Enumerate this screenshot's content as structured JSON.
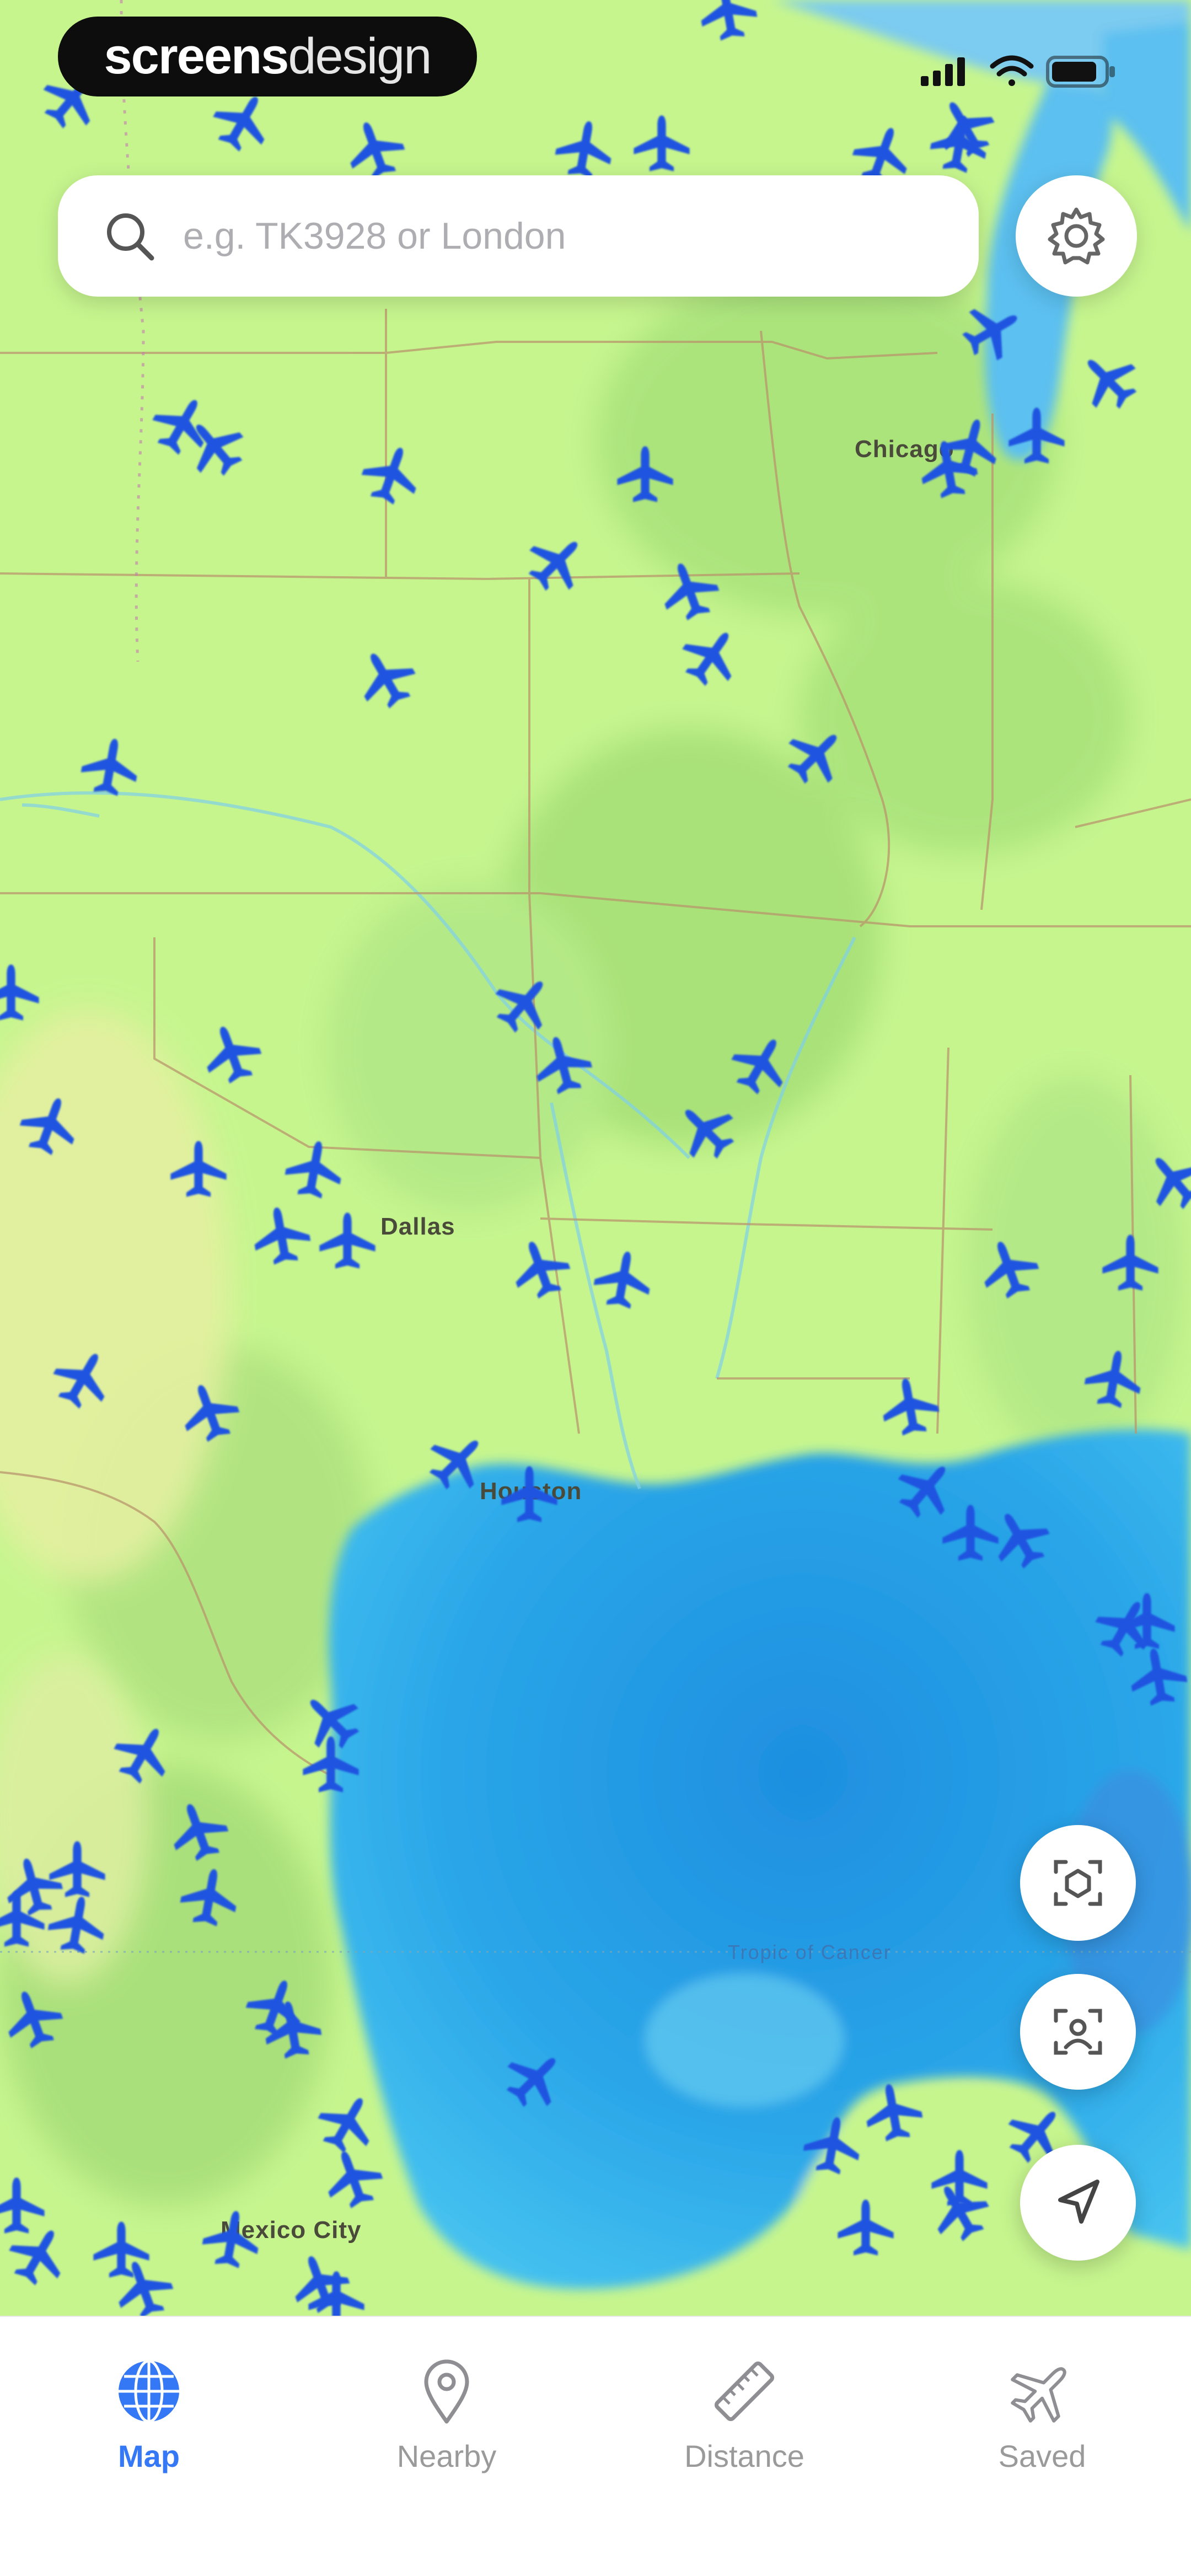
{
  "brand": {
    "part1": "screens",
    "part2": "design"
  },
  "search": {
    "placeholder": "e.g. TK3928 or London",
    "value": ""
  },
  "map": {
    "cities": [
      "Chicago",
      "Dallas",
      "Houston",
      "Mexico City"
    ],
    "water_labels": [
      "Tropic of Cancer"
    ],
    "colors": {
      "land": "#c6f58e",
      "land_dark": "#a9e47a",
      "water": "#2aa6e8",
      "plane": "#1f54e0"
    }
  },
  "fabs": [
    {
      "icon": "ar-scan-icon"
    },
    {
      "icon": "face-id-icon"
    },
    {
      "icon": "location-arrow-icon"
    }
  ],
  "tabs": [
    {
      "label": "Map",
      "icon": "globe-icon",
      "active": true
    },
    {
      "label": "Nearby",
      "icon": "pin-icon",
      "active": false
    },
    {
      "label": "Distance",
      "icon": "ruler-icon",
      "active": false
    },
    {
      "label": "Saved",
      "icon": "plane-icon",
      "active": false
    }
  ],
  "accent": "#3478f6"
}
